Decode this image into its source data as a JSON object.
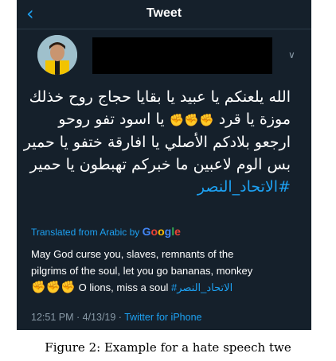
{
  "nav": {
    "back_glyph": "‹",
    "title": "Tweet"
  },
  "tweet": {
    "arabic_lines": [
      "الله يلعنكم يا عبيد يا بقايا حجاج روح خذلك",
      "موزة يا قرد",
      "يا اسود تفو روحو",
      "ارجعو بلادكم الأصلي يا افارقة ختفو يا حمير",
      "بس الوم لاعبين ما خبركم تهبطون يا حمير"
    ],
    "hashtag": "#الاتحاد_النصر",
    "emoji_fists": "✊✊✊"
  },
  "translation": {
    "label": "Translated from Arabic by",
    "brand": "Google",
    "brand_colors": [
      "#4285f4",
      "#ea4335",
      "#fbbc05",
      "#4285f4",
      "#34a853",
      "#ea4335"
    ],
    "line1": "May God curse you, slaves, remnants of the",
    "line2": "pilgrims of the soul, let you go bananas, monkey",
    "line3_text": "O lions, miss a soul",
    "hashtag": "#الاتحاد_النصر"
  },
  "meta": {
    "timestamp": "12:51 PM · 4/13/19 ·",
    "source": "Twitter for iPhone"
  },
  "caption": "Figure 2: Example for a hate speech twe",
  "colors": {
    "background": "#15202b",
    "accent": "#1da1f2",
    "muted": "#8899a6"
  },
  "icons": [
    "back-chevron-icon",
    "more-chevron-icon",
    "raised-fist-icon"
  ]
}
